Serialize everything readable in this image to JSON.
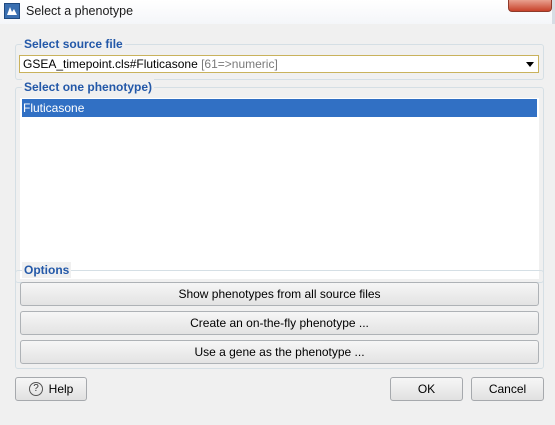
{
  "window": {
    "title": "Select a phenotype"
  },
  "source_group": {
    "label": "Select source file",
    "combo_value": "GSEA_timepoint.cls#Fluticasone",
    "combo_hint": "[61=>numeric]"
  },
  "phenotype_group": {
    "label": "Select one phenotype)",
    "items": [
      {
        "label": "Fluticasone",
        "selected": true
      }
    ]
  },
  "options_group": {
    "label": "Options",
    "buttons": [
      {
        "label": "Show phenotypes from all source files"
      },
      {
        "label": "Create an on-the-fly phenotype ..."
      },
      {
        "label": "Use a gene as the phenotype ..."
      }
    ]
  },
  "footer": {
    "help_label": "Help",
    "ok_label": "OK",
    "cancel_label": "Cancel"
  },
  "colors": {
    "group_label": "#2358a8",
    "selection": "#3170c4",
    "combo_border": "#c9b25c"
  }
}
